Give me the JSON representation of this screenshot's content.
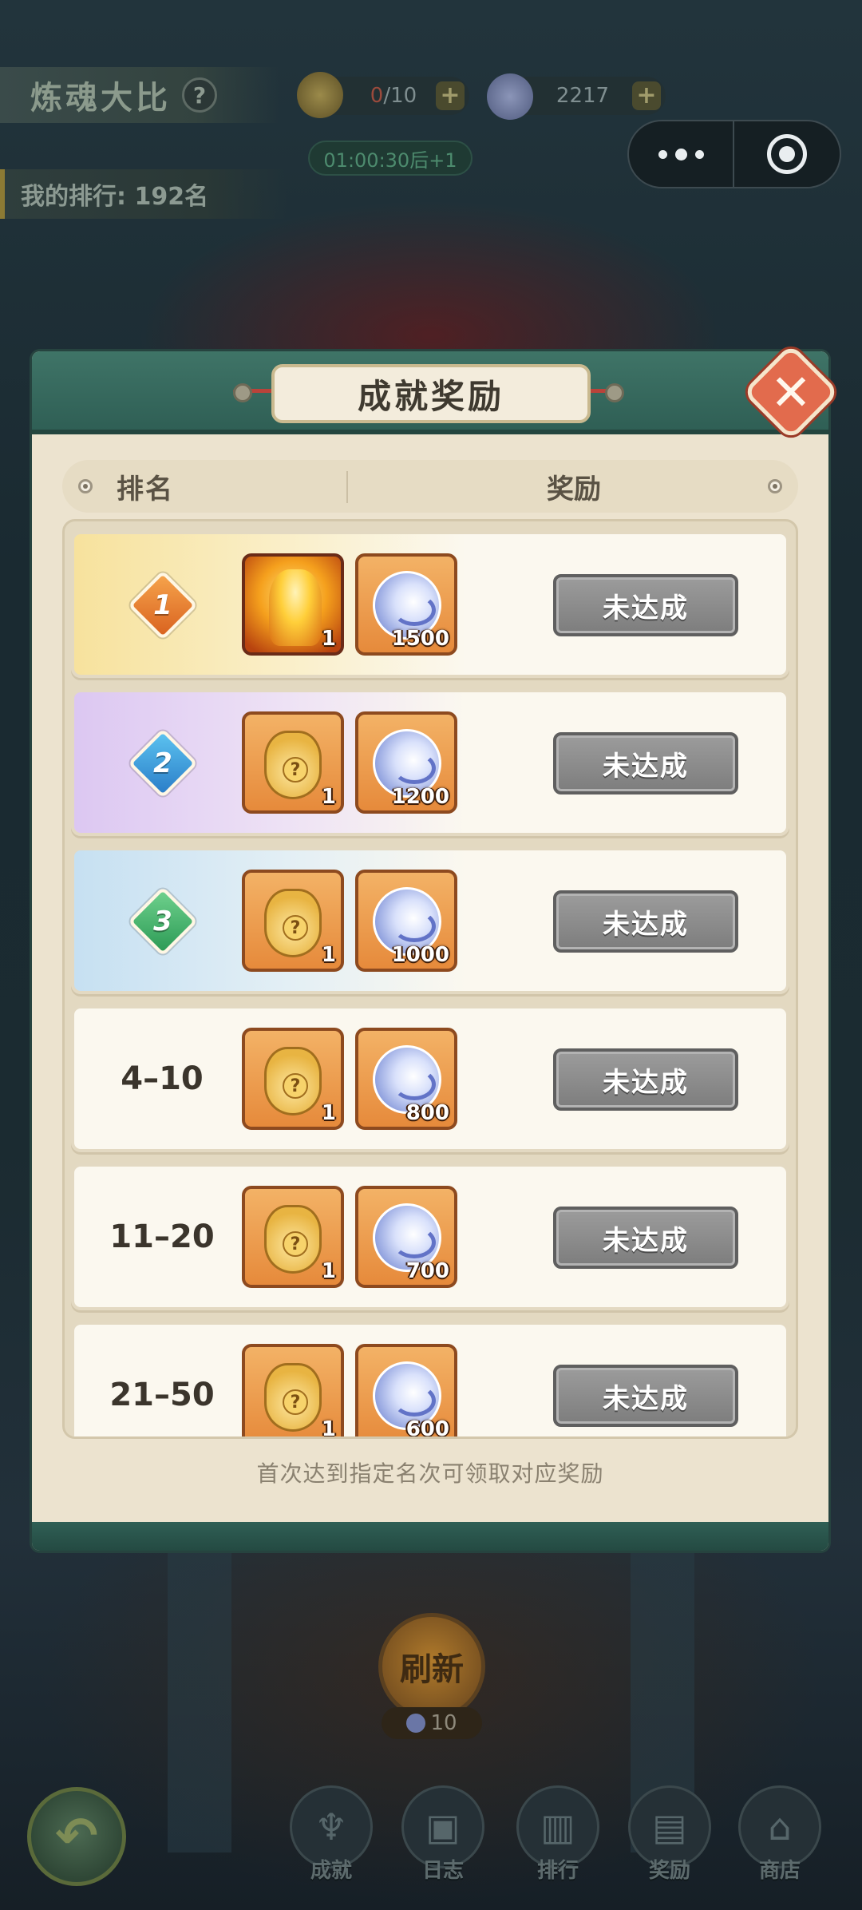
{
  "hud": {
    "mode_title": "炼魂大比",
    "stamina": {
      "current": "0",
      "max": "/10"
    },
    "soul_currency": "2217",
    "timer": "01:00:30后+1",
    "my_rank_label": "我的排行: 192名"
  },
  "dialog": {
    "title": "成就奖励",
    "header": {
      "rank": "排名",
      "reward": "奖励"
    },
    "rows": [
      {
        "rank": "1",
        "reward1_qty": "1",
        "reward2_qty": "1500",
        "status": "未达成"
      },
      {
        "rank": "2",
        "reward1_qty": "1",
        "reward2_qty": "1200",
        "status": "未达成"
      },
      {
        "rank": "3",
        "reward1_qty": "1",
        "reward2_qty": "1000",
        "status": "未达成"
      },
      {
        "rank": "4–10",
        "reward1_qty": "1",
        "reward2_qty": "800",
        "status": "未达成"
      },
      {
        "rank": "11–20",
        "reward1_qty": "1",
        "reward2_qty": "700",
        "status": "未达成"
      },
      {
        "rank": "21–50",
        "reward1_qty": "1",
        "reward2_qty": "600",
        "status": "未达成"
      }
    ],
    "hint": "首次达到指定名次可领取对应奖励"
  },
  "bottom": {
    "refresh_label": "刷新",
    "refresh_cost": "10",
    "nav": [
      {
        "label": "成就",
        "icon": "trophy-icon"
      },
      {
        "label": "日志",
        "icon": "log-icon"
      },
      {
        "label": "排行",
        "icon": "ranking-icon"
      },
      {
        "label": "奖励",
        "icon": "reward-chest-icon"
      },
      {
        "label": "商店",
        "icon": "shop-icon"
      }
    ]
  },
  "colors": {
    "dialog_frame": "#2f5f55",
    "panel_bg": "#ece3cf",
    "status_button": "#8a8a8a",
    "item_frame": "#e68a3b"
  }
}
